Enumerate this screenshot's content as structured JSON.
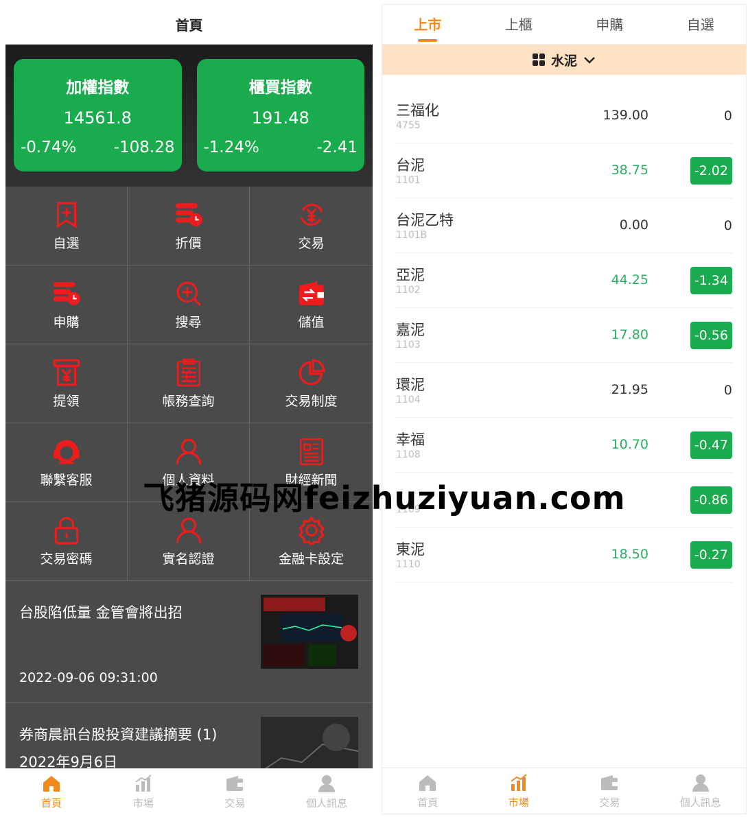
{
  "left": {
    "title": "首頁",
    "indices": [
      {
        "name": "加權指數",
        "value": "14561.8",
        "pct": "-0.74%",
        "chg": "-108.28"
      },
      {
        "name": "櫃買指數",
        "value": "191.48",
        "pct": "-1.24%",
        "chg": "-2.41"
      }
    ],
    "menu": [
      {
        "label": "自選",
        "icon": "bookmark-plus-icon"
      },
      {
        "label": "折價",
        "icon": "discount-clock-icon"
      },
      {
        "label": "交易",
        "icon": "yen-refresh-icon"
      },
      {
        "label": "申購",
        "icon": "subscribe-clock-icon"
      },
      {
        "label": "搜尋",
        "icon": "search-plus-icon"
      },
      {
        "label": "儲值",
        "icon": "wallet-icon"
      },
      {
        "label": "提領",
        "icon": "withdraw-yen-icon"
      },
      {
        "label": "帳務查詢",
        "icon": "ledger-icon"
      },
      {
        "label": "交易制度",
        "icon": "pie-chart-icon"
      },
      {
        "label": "聯繫客服",
        "icon": "customer-service-icon"
      },
      {
        "label": "個人資料",
        "icon": "user-icon"
      },
      {
        "label": "財經新聞",
        "icon": "news-icon"
      },
      {
        "label": "交易密碼",
        "icon": "lock-icon"
      },
      {
        "label": "實名認證",
        "icon": "user-verify-icon"
      },
      {
        "label": "金融卡設定",
        "icon": "gear-icon"
      }
    ],
    "news": [
      {
        "title": "台股陷低量 金管會將出招",
        "date": "2022-09-06 09:31:00"
      },
      {
        "title": "券商晨訊台股投資建議摘要 (1) 2022年9月6日",
        "date": ""
      }
    ],
    "tabs": [
      {
        "label": "首頁",
        "icon": "home-icon",
        "active": true
      },
      {
        "label": "市場",
        "icon": "market-chart-icon",
        "active": false
      },
      {
        "label": "交易",
        "icon": "trade-wallet-icon",
        "active": false
      },
      {
        "label": "個人訊息",
        "icon": "person-icon",
        "active": false
      }
    ]
  },
  "right": {
    "tabs": [
      "上市",
      "上櫃",
      "申購",
      "自選"
    ],
    "active_tab": 0,
    "category": "水泥",
    "stocks": [
      {
        "name": "三福化",
        "code": "4755",
        "price": "139.00",
        "change": "0",
        "down": false
      },
      {
        "name": "台泥",
        "code": "1101",
        "price": "38.75",
        "change": "-2.02",
        "down": true
      },
      {
        "name": "台泥乙特",
        "code": "1101B",
        "price": "0.00",
        "change": "0",
        "down": false
      },
      {
        "name": "亞泥",
        "code": "1102",
        "price": "44.25",
        "change": "-1.34",
        "down": true
      },
      {
        "name": "嘉泥",
        "code": "1103",
        "price": "17.80",
        "change": "-0.56",
        "down": true
      },
      {
        "name": "環泥",
        "code": "1104",
        "price": "21.95",
        "change": "0",
        "down": false
      },
      {
        "name": "幸福",
        "code": "1108",
        "price": "10.70",
        "change": "-0.47",
        "down": true
      },
      {
        "name": "",
        "code": "1109",
        "price": "",
        "change": "-0.86",
        "down": true
      },
      {
        "name": "東泥",
        "code": "1110",
        "price": "18.50",
        "change": "-0.27",
        "down": true
      }
    ],
    "bottom_tabs": [
      {
        "label": "首頁",
        "icon": "home-icon",
        "active": false
      },
      {
        "label": "市場",
        "icon": "market-chart-icon",
        "active": true
      },
      {
        "label": "交易",
        "icon": "trade-wallet-icon",
        "active": false
      },
      {
        "label": "個人訊息",
        "icon": "person-icon",
        "active": false
      }
    ]
  },
  "watermark": "飞猪源码网feizhuziyuan.com",
  "colors": {
    "accent": "#f08a1c",
    "green": "#1aab4e",
    "red_icon": "#ee1c1c",
    "category_bg": "#fde3c3"
  }
}
